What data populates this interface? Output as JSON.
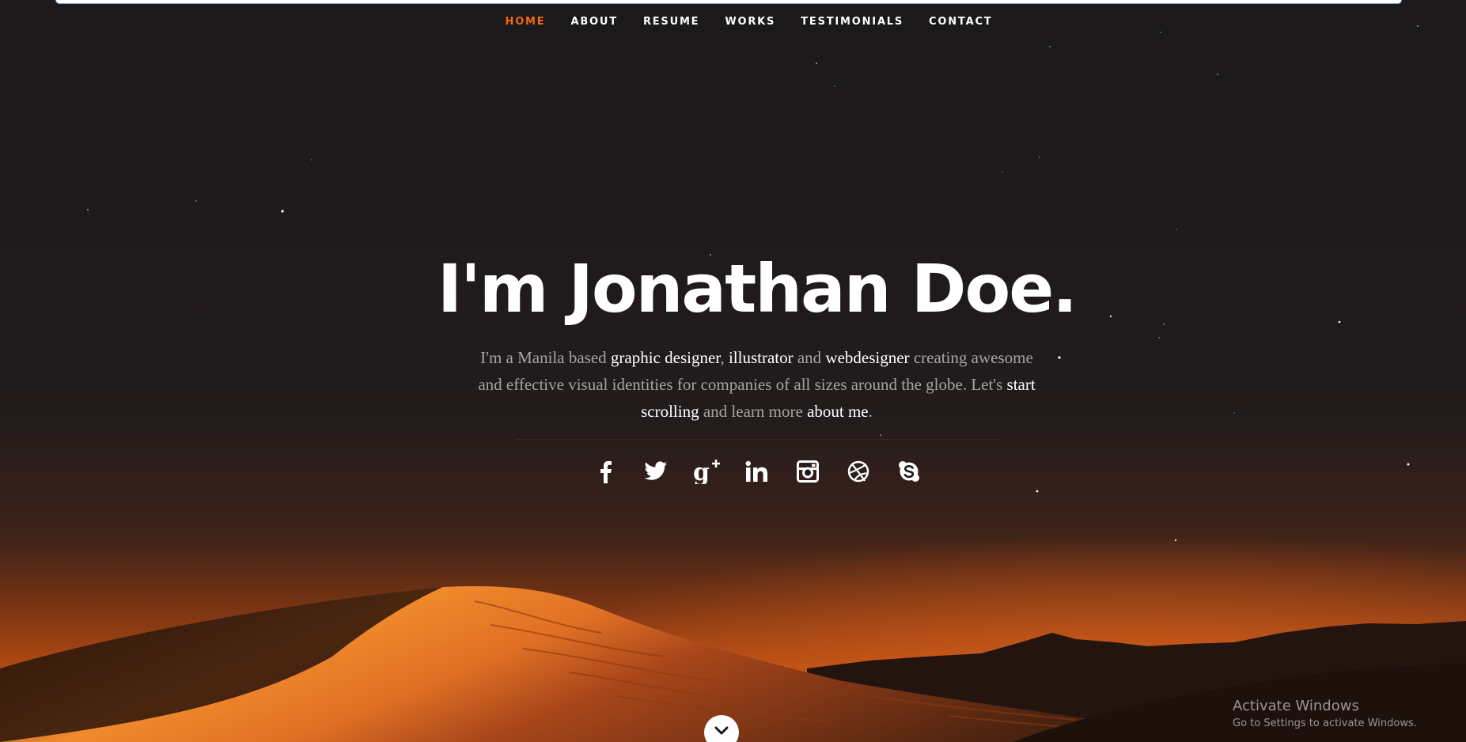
{
  "nav": {
    "items": [
      {
        "label": "HOME",
        "active": true
      },
      {
        "label": "ABOUT",
        "active": false
      },
      {
        "label": "RESUME",
        "active": false
      },
      {
        "label": "WORKS",
        "active": false
      },
      {
        "label": "TESTIMONIALS",
        "active": false
      },
      {
        "label": "CONTACT",
        "active": false
      }
    ]
  },
  "hero": {
    "title": "I'm Jonathan Doe.",
    "intro": {
      "t1": "I'm a Manila based ",
      "h1": "graphic designer",
      "t2": ", ",
      "h2": "illustrator",
      "t3": " and ",
      "h3": "webdesigner",
      "t4": " creating awesome and effective visual identities for companies of all sizes around the globe. Let's ",
      "h4": "start scrolling",
      "t5": " and learn more ",
      "h5": "about me",
      "t6": "."
    }
  },
  "social": [
    "facebook-icon",
    "twitter-icon",
    "google-plus-icon",
    "linkedin-icon",
    "instagram-icon",
    "dribbble-icon",
    "skype-icon"
  ],
  "windows_watermark": {
    "title": "Activate Windows",
    "subtitle": "Go to Settings to activate Windows."
  },
  "colors": {
    "accent": "#ef6a15",
    "background": "#1b191a",
    "dune": "#e0661e"
  }
}
